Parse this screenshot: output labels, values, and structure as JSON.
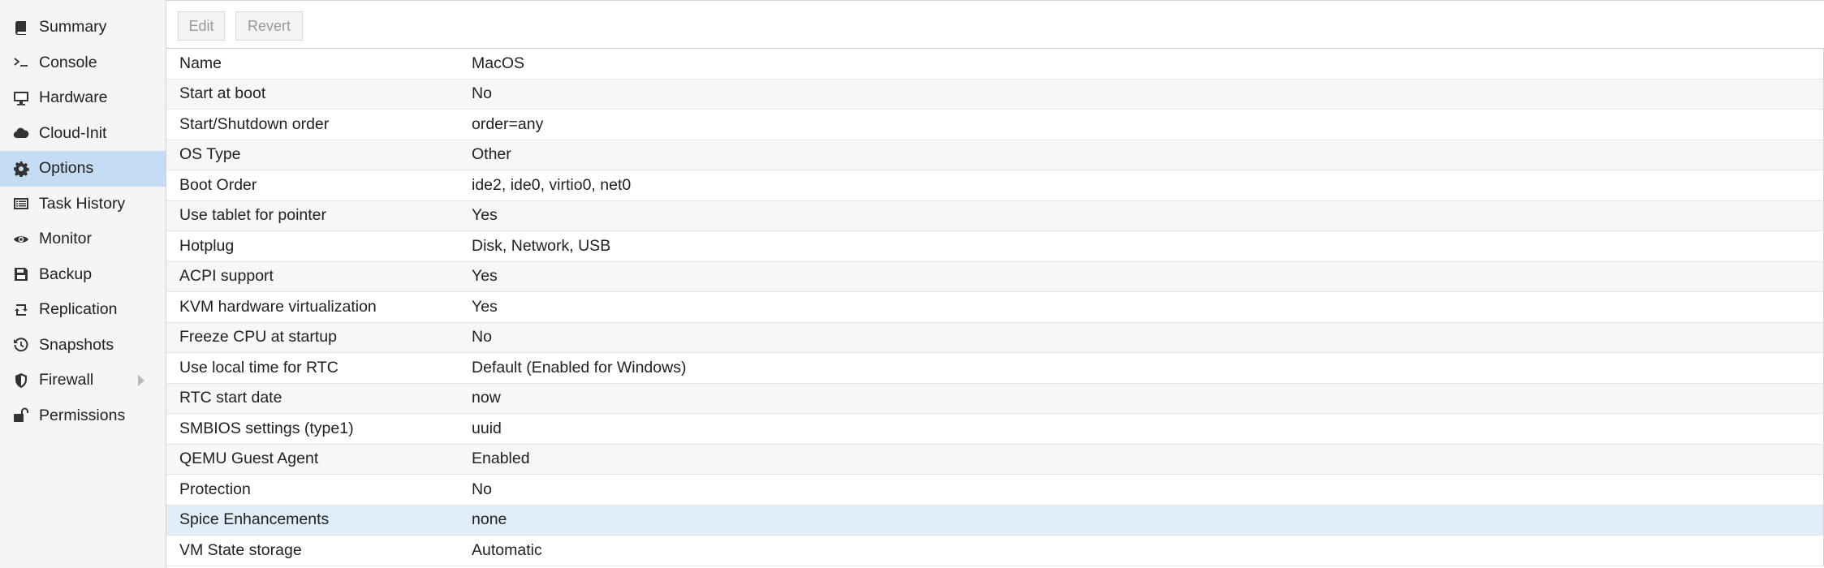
{
  "sidebar": {
    "items": [
      {
        "label": "Summary",
        "icon": "book-icon"
      },
      {
        "label": "Console",
        "icon": "terminal-icon"
      },
      {
        "label": "Hardware",
        "icon": "desktop-icon"
      },
      {
        "label": "Cloud-Init",
        "icon": "cloud-icon"
      },
      {
        "label": "Options",
        "icon": "gear-icon",
        "active": true
      },
      {
        "label": "Task History",
        "icon": "list-icon"
      },
      {
        "label": "Monitor",
        "icon": "eye-icon"
      },
      {
        "label": "Backup",
        "icon": "floppy-icon"
      },
      {
        "label": "Replication",
        "icon": "retweet-icon"
      },
      {
        "label": "Snapshots",
        "icon": "history-icon"
      },
      {
        "label": "Firewall",
        "icon": "shield-icon",
        "has_submenu": true
      },
      {
        "label": "Permissions",
        "icon": "unlock-icon"
      }
    ]
  },
  "toolbar": {
    "edit_label": "Edit",
    "revert_label": "Revert"
  },
  "options": {
    "rows": [
      {
        "key": "Name",
        "value": "MacOS"
      },
      {
        "key": "Start at boot",
        "value": "No"
      },
      {
        "key": "Start/Shutdown order",
        "value": "order=any"
      },
      {
        "key": "OS Type",
        "value": "Other"
      },
      {
        "key": "Boot Order",
        "value": "ide2, ide0, virtio0, net0"
      },
      {
        "key": "Use tablet for pointer",
        "value": "Yes"
      },
      {
        "key": "Hotplug",
        "value": "Disk, Network, USB"
      },
      {
        "key": "ACPI support",
        "value": "Yes"
      },
      {
        "key": "KVM hardware virtualization",
        "value": "Yes"
      },
      {
        "key": "Freeze CPU at startup",
        "value": "No"
      },
      {
        "key": "Use local time for RTC",
        "value": "Default (Enabled for Windows)"
      },
      {
        "key": "RTC start date",
        "value": "now"
      },
      {
        "key": "SMBIOS settings (type1)",
        "value": "uuid"
      },
      {
        "key": "QEMU Guest Agent",
        "value": "Enabled"
      },
      {
        "key": "Protection",
        "value": "No"
      },
      {
        "key": "Spice Enhancements",
        "value": "none",
        "selected": true
      },
      {
        "key": "VM State storage",
        "value": "Automatic"
      }
    ]
  },
  "colors": {
    "sidebar_bg": "#f5f5f5",
    "active_item_bg": "#c4dcf1",
    "selected_row_bg": "#e1eef9",
    "disabled_text": "#9a9a9a"
  }
}
